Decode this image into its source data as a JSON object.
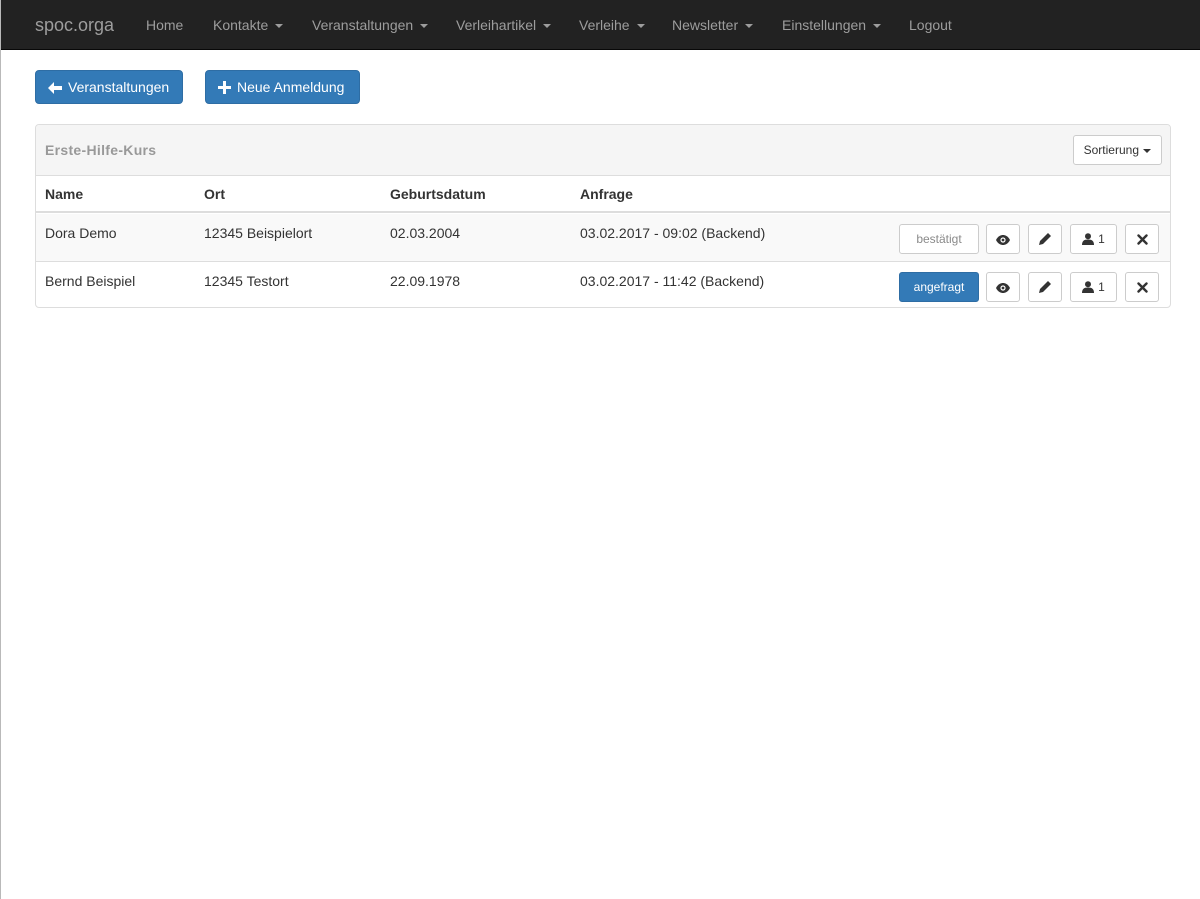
{
  "navbar": {
    "brand": "spoc.orga",
    "items": [
      {
        "label": "Home",
        "dropdown": false
      },
      {
        "label": "Kontakte",
        "dropdown": true
      },
      {
        "label": "Veranstaltungen",
        "dropdown": true
      },
      {
        "label": "Verleihartikel",
        "dropdown": true
      },
      {
        "label": "Verleihe",
        "dropdown": true
      },
      {
        "label": "Newsletter",
        "dropdown": true
      },
      {
        "label": "Einstellungen",
        "dropdown": true
      },
      {
        "label": "Logout",
        "dropdown": false
      }
    ]
  },
  "actions": {
    "back_label": "Veranstaltungen",
    "new_label": "Neue Anmeldung"
  },
  "panel": {
    "title": "Erste-Hilfe-Kurs",
    "sort_label": "Sortierung"
  },
  "table": {
    "headers": [
      "Name",
      "Ort",
      "Geburtsdatum",
      "Anfrage"
    ],
    "rows": [
      {
        "name": "Dora Demo",
        "ort": "12345 Beispielort",
        "geburtsdatum": "02.03.2004",
        "anfrage": "03.02.2017 - 09:02 (Backend)",
        "status": "bestätigt",
        "status_type": "confirmed",
        "persons": "1"
      },
      {
        "name": "Bernd Beispiel",
        "ort": "12345 Testort",
        "geburtsdatum": "22.09.1978",
        "anfrage": "03.02.2017 - 11:42 (Backend)",
        "status": "angefragt",
        "status_type": "requested",
        "persons": "1"
      }
    ]
  },
  "icons": {
    "back": "arrow-left-icon",
    "new": "plus-icon",
    "view": "eye-icon",
    "edit": "pencil-icon",
    "persons": "user-icon",
    "delete": "close-icon"
  },
  "colors": {
    "navbar_bg": "#222222",
    "nav_text": "#9d9d9d",
    "primary": "#337ab7"
  }
}
